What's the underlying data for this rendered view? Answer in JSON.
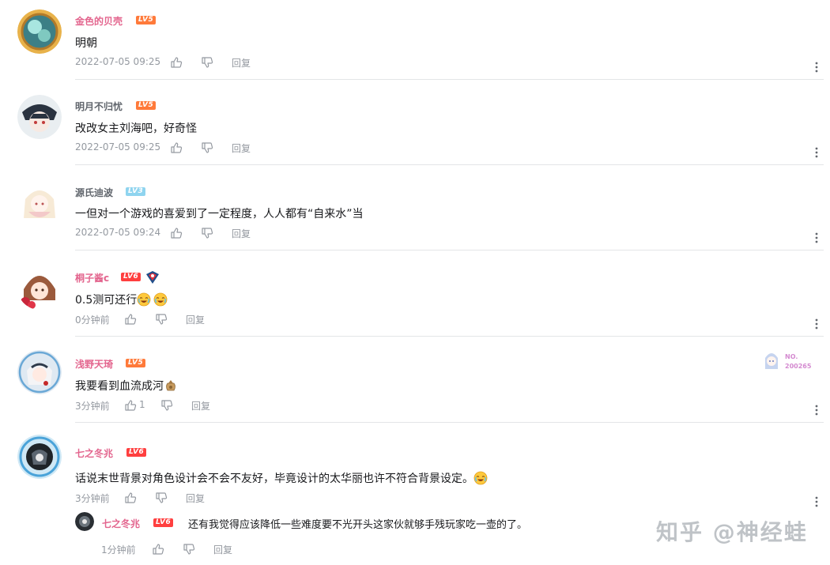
{
  "comments": [
    {
      "user": "金色的贝壳",
      "level": "LV5",
      "text": "明朝",
      "time": "2022-07-05 09:25",
      "reply": "回复"
    },
    {
      "user": "明月不归忧",
      "level": "LV5",
      "text": "改改女主刘海吧，好奇怪",
      "time": "2022-07-05 09:25",
      "reply": "回复"
    },
    {
      "user": "源氏迪波",
      "level": "LV3",
      "text": "一但对一个游戏的喜爱到了一定程度，人人都有“自来水”当",
      "time": "2022-07-05 09:24",
      "reply": "回复"
    },
    {
      "user": "桐子酱c",
      "level": "LV6",
      "text": "0.5测可还行",
      "time": "0分钟前",
      "reply": "回复"
    },
    {
      "user": "浅野天琦",
      "level": "LV5",
      "text": "我要看到血流成河",
      "time": "3分钟前",
      "likes": "1",
      "reply": "回复",
      "fan_badge": {
        "line1": "NO.",
        "line2": "200265"
      }
    },
    {
      "user": "七之冬兆",
      "level": "LV6",
      "text": "话说末世背景对角色设计会不会不友好，毕竟设计的太华丽也许不符合背景设定。",
      "time": "3分钟前",
      "reply": "回复"
    }
  ],
  "sub_reply": {
    "user": "七之冬兆",
    "level": "LV6",
    "text": "还有我觉得应该降低一些难度要不光开头这家伙就够手残玩家吃一壶的了。",
    "time": "1分钟前",
    "reply": "回复"
  },
  "watermark": "知乎 @神经蛙",
  "colors": {
    "username_pink": "#e3658e",
    "username_gray": "#61666d",
    "meta": "#9499a0",
    "divider": "#e3e5e7",
    "level5": "#ff7a3a",
    "level3": "#8fd4ef",
    "level6": "#ff3f3f"
  },
  "icons": [
    "like-icon",
    "dislike-icon",
    "more-icon",
    "laugh-cry-emoji",
    "sack-emoji"
  ]
}
